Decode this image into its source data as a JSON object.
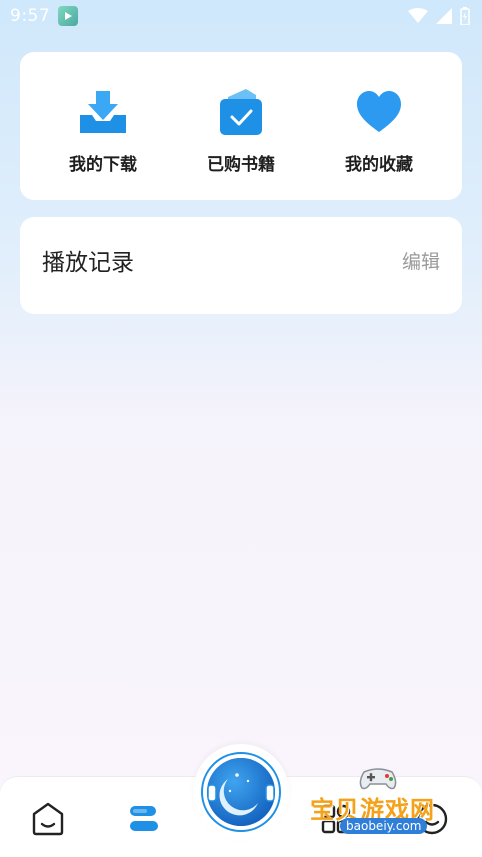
{
  "status_bar": {
    "time": "9:57"
  },
  "quick_actions": [
    {
      "label": "我的下载",
      "icon": "download-tray-icon"
    },
    {
      "label": "已购书籍",
      "icon": "purchased-bag-check-icon"
    },
    {
      "label": "我的收藏",
      "icon": "heart-icon"
    }
  ],
  "history": {
    "title": "播放记录",
    "edit_label": "编辑"
  },
  "bottom_nav": {
    "items": [
      {
        "name": "home",
        "icon": "home-smile-icon"
      },
      {
        "name": "bookshelf",
        "icon": "bookshelf-icon"
      },
      {
        "name": "center",
        "icon": "astronaut-moon-icon"
      },
      {
        "name": "discover",
        "icon": "grid-icon"
      },
      {
        "name": "profile",
        "icon": "smile-face-icon"
      }
    ]
  },
  "watermark": {
    "text": "宝贝游戏网",
    "url": "baobeiy.com"
  },
  "colors": {
    "accent": "#1e90e6",
    "accent_light": "#3aa8f5",
    "edit_gray": "#9a9a9a",
    "watermark_orange": "#f3a21a"
  }
}
